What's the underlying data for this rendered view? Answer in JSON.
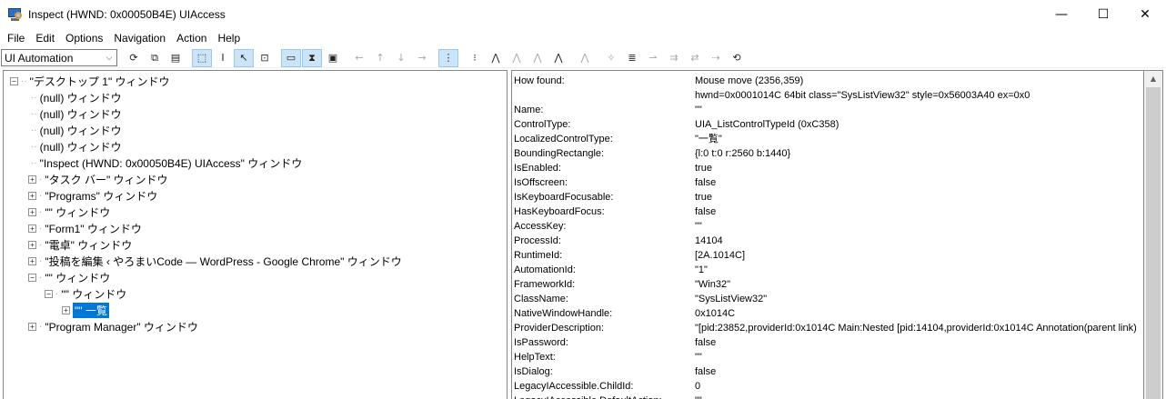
{
  "window": {
    "title": "Inspect  (HWND: 0x00050B4E) UIAccess",
    "minimize": "—",
    "maximize": "☐",
    "close": "✕"
  },
  "menu": [
    "File",
    "Edit",
    "Options",
    "Navigation",
    "Action",
    "Help"
  ],
  "toolbar": {
    "mode_value": "UI Automation",
    "mode_arrow": "⌵"
  },
  "tree": {
    "root": "\"デスクトップ 1\" ウィンドウ",
    "items": [
      "(null) ウィンドウ",
      "(null) ウィンドウ",
      "(null) ウィンドウ",
      "(null) ウィンドウ",
      "\"Inspect  (HWND: 0x00050B4E) UIAccess\" ウィンドウ",
      "\"タスク バー\" ウィンドウ",
      "\"Programs\" ウィンドウ",
      "\"\" ウィンドウ",
      "\"Form1\" ウィンドウ",
      "\"電卓\" ウィンドウ",
      "\"投稿を編集 ‹ やろまいCode — WordPress - Google Chrome\" ウィンドウ",
      "\"\" ウィンドウ",
      "\"\" ウィンドウ",
      "\"\" 一覧",
      "\"Program Manager\" ウィンドウ"
    ]
  },
  "properties": [
    {
      "key": "How found:",
      "value": "Mouse move (2356,359)"
    },
    {
      "key": "",
      "value": "hwnd=0x0001014C 64bit class=\"SysListView32\" style=0x56003A40 ex=0x0"
    },
    {
      "key": "Name:",
      "value": "\"\""
    },
    {
      "key": "ControlType:",
      "value": "UIA_ListControlTypeId (0xC358)"
    },
    {
      "key": "LocalizedControlType:",
      "value": "\"一覧\""
    },
    {
      "key": "BoundingRectangle:",
      "value": "{l:0 t:0 r:2560 b:1440}"
    },
    {
      "key": "IsEnabled:",
      "value": "true"
    },
    {
      "key": "IsOffscreen:",
      "value": "false"
    },
    {
      "key": "IsKeyboardFocusable:",
      "value": "true"
    },
    {
      "key": "HasKeyboardFocus:",
      "value": "false"
    },
    {
      "key": "AccessKey:",
      "value": "\"\""
    },
    {
      "key": "ProcessId:",
      "value": "14104"
    },
    {
      "key": "RuntimeId:",
      "value": "[2A.1014C]"
    },
    {
      "key": "AutomationId:",
      "value": "\"1\""
    },
    {
      "key": "FrameworkId:",
      "value": "\"Win32\""
    },
    {
      "key": "ClassName:",
      "value": "\"SysListView32\""
    },
    {
      "key": "NativeWindowHandle:",
      "value": "0x1014C"
    },
    {
      "key": "ProviderDescription:",
      "value": "\"[pid:23852,providerId:0x1014C Main:Nested [pid:14104,providerId:0x1014C Annotation(parent link)"
    },
    {
      "key": "IsPassword:",
      "value": "false"
    },
    {
      "key": "HelpText:",
      "value": "\"\""
    },
    {
      "key": "IsDialog:",
      "value": "false"
    },
    {
      "key": "LegacyIAccessible.ChildId:",
      "value": "0"
    },
    {
      "key": "LegacyIAccessible.DefaultAction:",
      "value": "\"\""
    }
  ],
  "colors": {
    "selection": "#0078d7",
    "toolbar_selected": "#cce4f7"
  }
}
